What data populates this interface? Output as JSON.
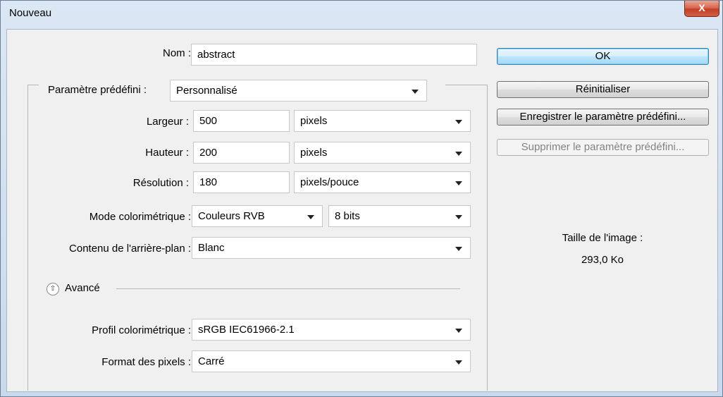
{
  "window": {
    "title": "Nouveau",
    "close_glyph": "X"
  },
  "fields": {
    "name": {
      "label": "Nom :",
      "value": "abstract"
    },
    "preset": {
      "label": "Paramètre prédéfini :",
      "value": "Personnalisé"
    },
    "width": {
      "label": "Largeur :",
      "value": "500",
      "unit": "pixels"
    },
    "height": {
      "label": "Hauteur :",
      "value": "200",
      "unit": "pixels"
    },
    "resolution": {
      "label": "Résolution :",
      "value": "180",
      "unit": "pixels/pouce"
    },
    "color_mode": {
      "label": "Mode colorimétrique :",
      "value": "Couleurs RVB",
      "depth": "8 bits"
    },
    "background": {
      "label": "Contenu de l'arrière-plan :",
      "value": "Blanc"
    }
  },
  "advanced": {
    "toggle_label": "Avancé",
    "profile": {
      "label": "Profil colorimétrique :",
      "value": "sRGB IEC61966-2.1"
    },
    "pixel_aspect": {
      "label": "Format des pixels :",
      "value": "Carré"
    }
  },
  "buttons": {
    "ok": "OK",
    "reset": "Réinitialiser",
    "save_preset": "Enregistrer le paramètre prédéfini...",
    "delete_preset": "Supprimer le paramètre prédéfini..."
  },
  "image_size": {
    "label": "Taille de l'image :",
    "value": "293,0 Ko"
  },
  "colors": {
    "accent": "#3c7fb1",
    "frame": "#c9daee",
    "client_bg": "#f0f0f0"
  },
  "icons": {
    "close": "close-icon",
    "expand": "chevron-double-up-icon"
  }
}
